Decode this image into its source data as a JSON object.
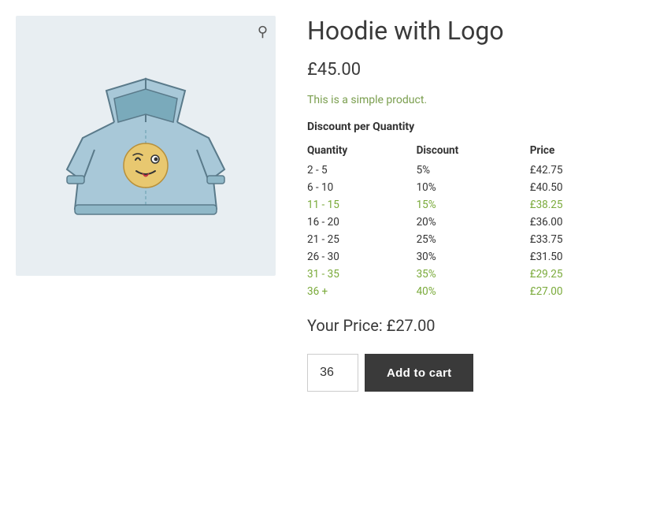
{
  "product": {
    "title": "Hoodie with Logo",
    "price": "£45.00",
    "description": "This is a simple product.",
    "discount_section_title": "Discount per Quantity",
    "table_headers": [
      "Quantity",
      "Discount",
      "Price"
    ],
    "discount_rows": [
      {
        "quantity": "2 - 5",
        "discount": "5%",
        "price": "£42.75",
        "highlighted": false
      },
      {
        "quantity": "6 - 10",
        "discount": "10%",
        "price": "£40.50",
        "highlighted": false
      },
      {
        "quantity": "11 - 15",
        "discount": "15%",
        "price": "£38.25",
        "highlighted": true
      },
      {
        "quantity": "16 - 20",
        "discount": "20%",
        "price": "£36.00",
        "highlighted": false
      },
      {
        "quantity": "21 - 25",
        "discount": "25%",
        "price": "£33.75",
        "highlighted": false
      },
      {
        "quantity": "26 - 30",
        "discount": "30%",
        "price": "£31.50",
        "highlighted": false
      },
      {
        "quantity": "31 - 35",
        "discount": "35%",
        "price": "£29.25",
        "highlighted": true
      },
      {
        "quantity": "36 +",
        "discount": "40%",
        "price": "£27.00",
        "highlighted": true
      }
    ],
    "your_price_label": "Your Price: £27.00",
    "quantity_value": "36",
    "add_to_cart_label": "Add to cart"
  }
}
